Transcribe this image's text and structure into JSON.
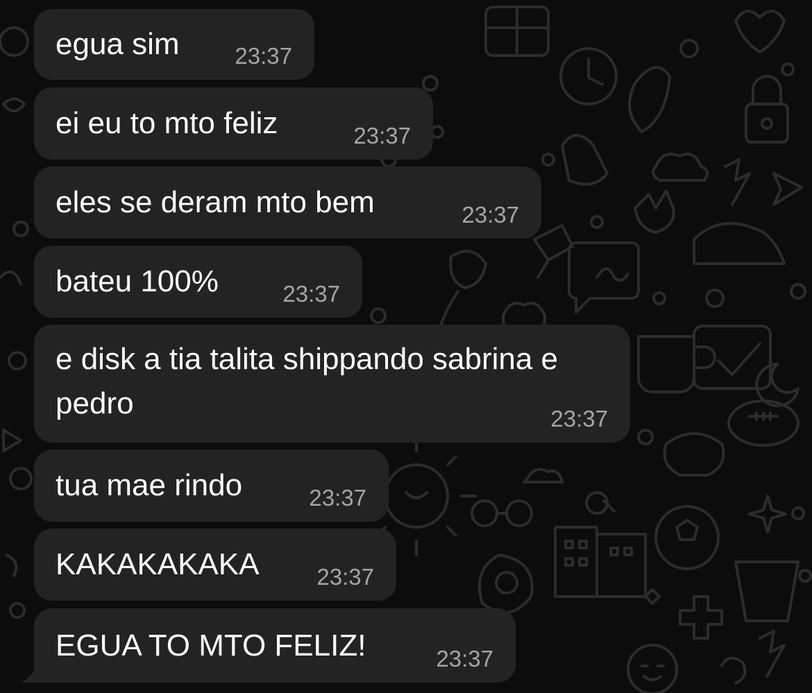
{
  "conversation": {
    "messages": [
      {
        "text": "egua sim",
        "time": "23:37"
      },
      {
        "text": "ei eu to mto feliz",
        "time": "23:37"
      },
      {
        "text": "eles se deram mto bem",
        "time": "23:37"
      },
      {
        "text": "bateu 100%",
        "time": "23:37"
      },
      {
        "text": "e disk a tia talita shippando sabrina e pedro",
        "time": "23:37"
      },
      {
        "text": "tua mae rindo",
        "time": "23:37"
      },
      {
        "text": "KAKAKAKAKA",
        "time": "23:37"
      },
      {
        "text": "EGUA TO MTO FELIZ!",
        "time": "23:37"
      }
    ]
  },
  "colors": {
    "background": "#0c0c0c",
    "bubble": "#222325",
    "text": "#ffffff",
    "timestamp": "#a6a6a8",
    "doodle": "#2b2b2d"
  },
  "wallpaper": {
    "icons": [
      "doodle-icon"
    ]
  }
}
